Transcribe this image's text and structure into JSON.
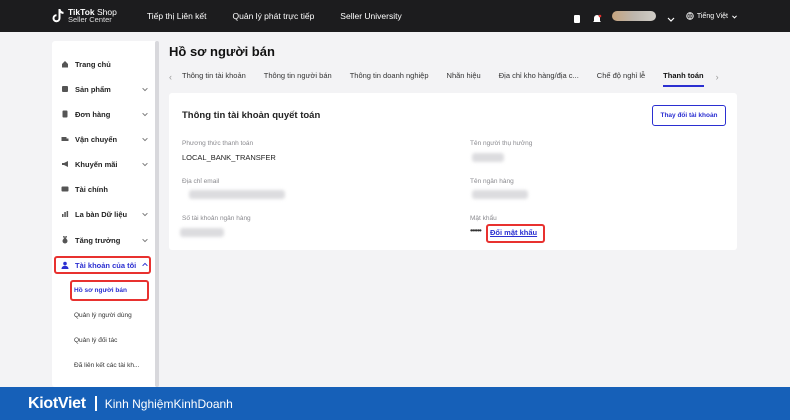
{
  "topbar": {
    "logo_brand": "TikTok",
    "logo_shop": " Shop",
    "logo_sub": "Seller Center",
    "nav": [
      "Tiếp thị Liên kết",
      "Quản lý phát trực tiếp",
      "Seller University"
    ],
    "language": "Tiếng Việt"
  },
  "sidebar": {
    "items": [
      {
        "label": "Trang chủ",
        "icon": "home-icon"
      },
      {
        "label": "Sản phẩm",
        "icon": "box-icon"
      },
      {
        "label": "Đơn hàng",
        "icon": "order-icon"
      },
      {
        "label": "Vận chuyển",
        "icon": "truck-icon"
      },
      {
        "label": "Khuyến mãi",
        "icon": "megaphone-icon"
      },
      {
        "label": "Tài chính",
        "icon": "finance-icon"
      },
      {
        "label": "La bàn Dữ liệu",
        "icon": "chart-icon"
      },
      {
        "label": "Tăng trưởng",
        "icon": "medal-icon"
      },
      {
        "label": "Tài khoản của tôi",
        "icon": "account-icon"
      }
    ],
    "subitems": [
      "Hồ sơ người bán",
      "Quản lý người dùng",
      "Quản lý đối tác",
      "Đã liên kết các tài kh..."
    ]
  },
  "main": {
    "title": "Hồ sơ người bán",
    "tabs": [
      "Thông tin tài khoản",
      "Thông tin người bán",
      "Thông tin doanh nghiệp",
      "Nhãn hiệu",
      "Địa chỉ kho hàng/địa c...",
      "Chế độ nghỉ lễ",
      "Thanh toán"
    ],
    "active_tab": "Thanh toán",
    "card": {
      "title": "Thông tin tài khoản quyết toán",
      "change_button": "Thay đổi tài khoản",
      "payment_method_label": "Phương thức thanh toán",
      "payment_method_value": "LOCAL_BANK_TRANSFER",
      "beneficiary_label": "Tên người thụ hưởng",
      "email_label": "Địa chỉ email",
      "bank_name_label": "Tên ngân hàng",
      "account_number_label": "Số tài khoản ngân hàng",
      "password_label": "Mật khẩu",
      "password_mask": "••••••",
      "change_password_link": "Đổi mật khẩu"
    }
  },
  "footer": {
    "brand": "KiotViet",
    "tagline": "Kinh NghiệmKinhDoanh"
  },
  "colors": {
    "accent": "#2b2fd1",
    "highlight": "#e8312f",
    "footer": "#1660b8"
  }
}
